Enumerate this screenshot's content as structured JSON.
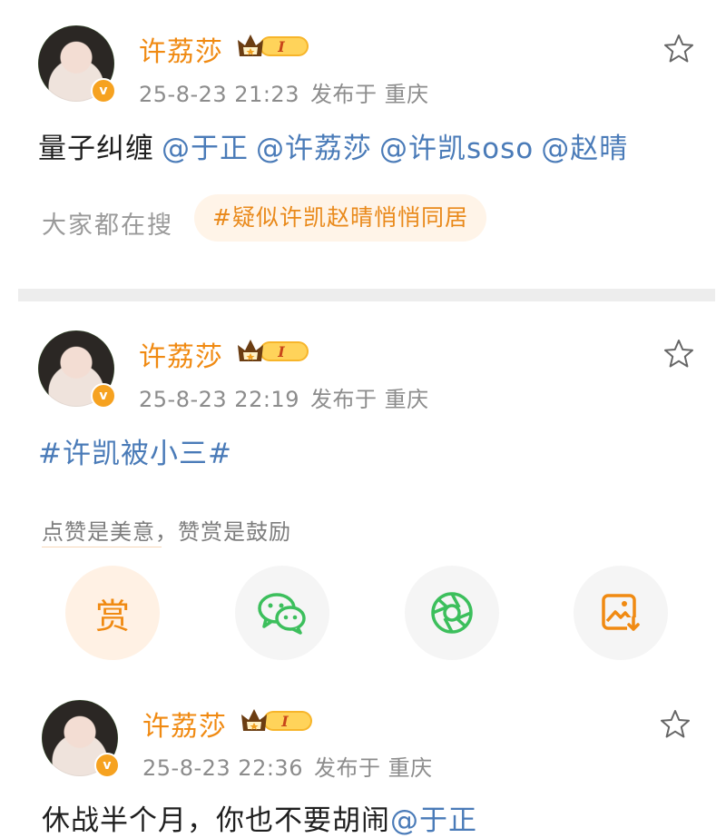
{
  "posts": [
    {
      "author": "许荔莎",
      "vip_level": "I",
      "time": "25-8-23 21:23",
      "published_at": "发布于 重庆",
      "content_text": "量子纠缠",
      "mentions": [
        "@于正",
        "@许荔莎",
        "@许凯soso",
        "@赵晴"
      ],
      "search_label": "大家都在搜",
      "search_tag": "#疑似许凯赵晴悄悄同居"
    },
    {
      "author": "许荔莎",
      "vip_level": "I",
      "time": "25-8-23 22:19",
      "published_at": "发布于 重庆",
      "topic": "#许凯被小三#",
      "reward_tip": "点赞是美意，赞赏是鼓励",
      "share_actions": [
        {
          "label": "赏",
          "icon": "reward-icon"
        },
        {
          "icon": "wechat-icon"
        },
        {
          "icon": "moments-icon"
        },
        {
          "icon": "save-image-icon"
        }
      ]
    },
    {
      "author": "许荔莎",
      "vip_level": "I",
      "time": "25-8-23 22:36",
      "published_at": "发布于 重庆",
      "content_text": "休战半个月，你也不要胡闹",
      "mentions": [
        "@于正"
      ]
    }
  ],
  "colors": {
    "name": "#f08a12",
    "link": "#4a7bb8",
    "meta": "#8c8c8c",
    "pill_bg": "#fff4e8"
  }
}
